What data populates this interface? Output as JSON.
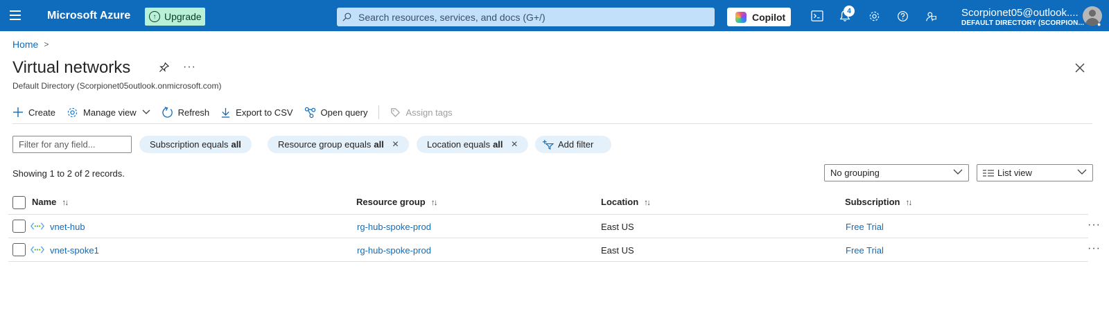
{
  "topbar": {
    "brand": "Microsoft Azure",
    "upgrade_label": "Upgrade",
    "search_placeholder": "Search resources, services, and docs (G+/)",
    "copilot_label": "Copilot",
    "notification_count": "4",
    "account_name": "Scorpionet05@outlook....",
    "account_directory": "DEFAULT DIRECTORY (SCORPION...",
    "accent_color": "#0f6cbd",
    "icons": [
      "menu-icon",
      "cloud-shell-icon",
      "bell-icon",
      "gear-icon",
      "help-icon",
      "feedback-icon"
    ]
  },
  "breadcrumb": {
    "home": "Home",
    "separator": ">"
  },
  "page": {
    "title": "Virtual networks",
    "subtitle": "Default Directory (Scorpionet05outlook.onmicrosoft.com)",
    "more": "···"
  },
  "toolbar": {
    "create": "Create",
    "manage_view": "Manage view",
    "refresh": "Refresh",
    "export_csv": "Export to CSV",
    "open_query": "Open query",
    "assign_tags": "Assign tags"
  },
  "filters": {
    "placeholder": "Filter for any field...",
    "subscription_prefix": "Subscription equals",
    "subscription_value": "all",
    "resource_group_prefix": "Resource group equals",
    "resource_group_value": "all",
    "location_prefix": "Location equals",
    "location_value": "all",
    "add_filter": "Add filter"
  },
  "records_text": "Showing 1 to 2 of 2 records.",
  "grouping": {
    "selected": "No grouping"
  },
  "view": {
    "selected": "List view"
  },
  "table": {
    "columns": [
      "Name",
      "Resource group",
      "Location",
      "Subscription"
    ],
    "rows": [
      {
        "name": "vnet-hub",
        "resource_group": "rg-hub-spoke-prod",
        "location": "East US",
        "subscription": "Free Trial"
      },
      {
        "name": "vnet-spoke1",
        "resource_group": "rg-hub-spoke-prod",
        "location": "East US",
        "subscription": "Free Trial"
      }
    ],
    "row_more": "···"
  }
}
